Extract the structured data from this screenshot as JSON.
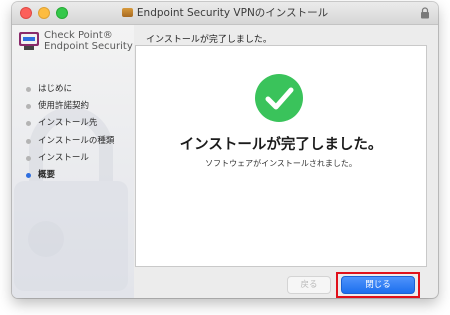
{
  "window": {
    "title": "Endpoint Security VPNのインストール"
  },
  "brand": {
    "line1": "Check Point®",
    "line2": "Endpoint Security"
  },
  "steps": [
    {
      "label": "はじめに",
      "active": false
    },
    {
      "label": "使用許諾契約",
      "active": false
    },
    {
      "label": "インストール先",
      "active": false
    },
    {
      "label": "インストールの種類",
      "active": false
    },
    {
      "label": "インストール",
      "active": false
    },
    {
      "label": "概要",
      "active": true
    }
  ],
  "main": {
    "header": "インストールが完了しました。",
    "headline": "インストールが完了しました。",
    "subtext": "ソフトウェアがインストールされました。"
  },
  "buttons": {
    "back_label": "戻る",
    "close_label": "閉じる"
  },
  "icons": {
    "success": "checkmark-circle-icon",
    "lock": "lock-icon"
  },
  "colors": {
    "accent": "#1c6fee",
    "success": "#3ac35b",
    "highlight": "#e0101a"
  }
}
